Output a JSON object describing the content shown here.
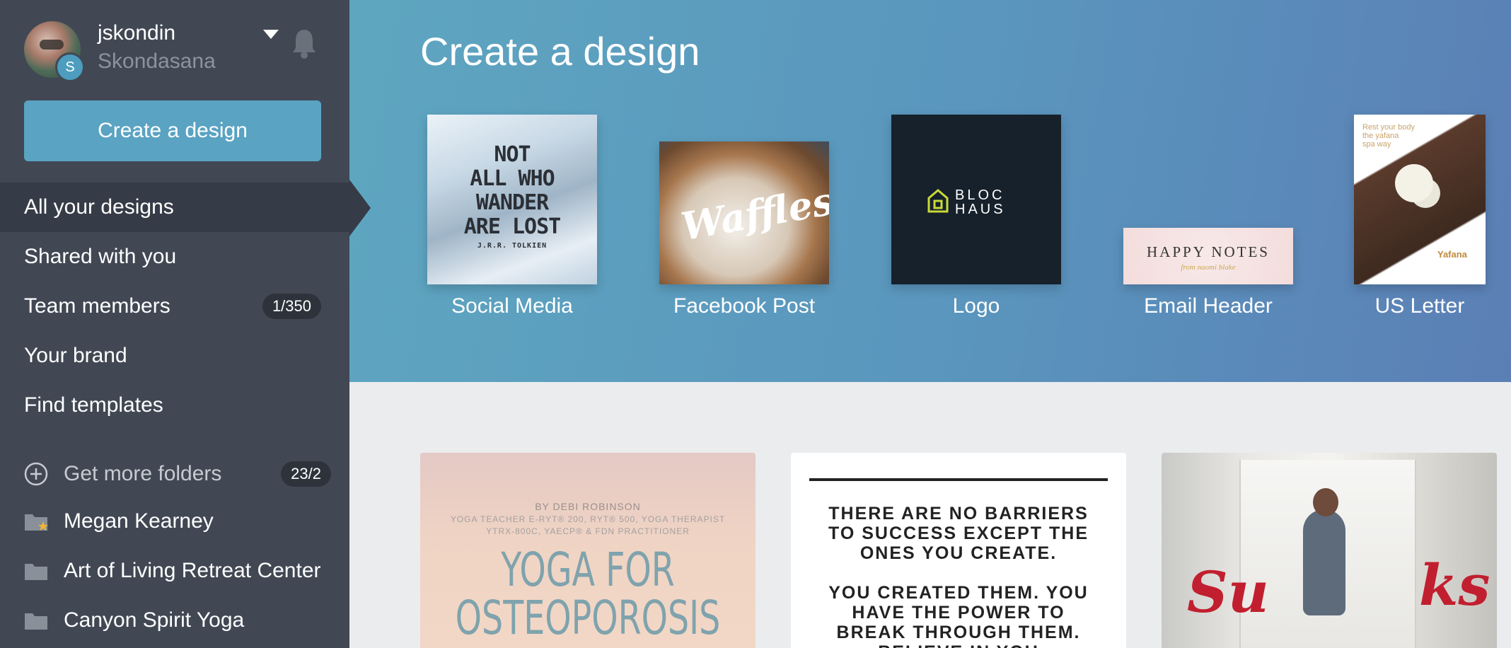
{
  "profile": {
    "username": "jskondin",
    "team": "Skondasana",
    "avatar_letter": "S"
  },
  "sidebar": {
    "create_label": "Create a design",
    "nav": [
      {
        "label": "All your designs"
      },
      {
        "label": "Shared with you"
      },
      {
        "label": "Team members",
        "badge": "1/350"
      },
      {
        "label": "Your brand"
      },
      {
        "label": "Find templates"
      }
    ],
    "more_folders": {
      "label": "Get more folders",
      "badge": "23/2"
    },
    "folders": [
      {
        "label": "Megan Kearney",
        "icon": "folder-star-icon"
      },
      {
        "label": "Art of Living Retreat Center",
        "icon": "folder-icon"
      },
      {
        "label": "Canyon Spirit Yoga",
        "icon": "folder-icon"
      }
    ]
  },
  "banner": {
    "title": "Create a design",
    "templates": [
      {
        "label": "Social Media",
        "thumb_text": [
          "NOT",
          "ALL WHO",
          "WANDER",
          "ARE LOST"
        ],
        "thumb_sub": "J.R.R. TOLKIEN"
      },
      {
        "label": "Facebook Post",
        "thumb_text": "Waffles"
      },
      {
        "label": "Logo",
        "thumb_text": [
          "BLOC",
          "HAUS"
        ]
      },
      {
        "label": "Email Header",
        "thumb_text": "HAPPY NOTES",
        "thumb_sub": "from naomi blake"
      },
      {
        "label": "US Letter",
        "thumb_text": [
          "Rest your body",
          "the yafana",
          "spa way"
        ],
        "thumb_sub": "Yafana"
      }
    ]
  },
  "designs": [
    {
      "by": "BY DEBI ROBINSON",
      "credits": [
        "YOGA TEACHER E-RYT® 200, RYT® 500, YOGA THERAPIST",
        "YTRX-800C, YAECP® & FDN PRACTITIONER"
      ],
      "title": [
        "YOGA FOR",
        "OSTEOPOROSIS"
      ]
    },
    {
      "lines": [
        "THERE ARE NO BARRIERS",
        "TO SUCCESS EXCEPT THE",
        "ONES YOU CREATE.",
        "",
        "YOU CREATED THEM. YOU",
        "HAVE THE POWER TO",
        "BREAK THROUGH THEM.",
        "BELIEVE IN YOU"
      ]
    },
    {
      "overlay_left": "Su",
      "overlay_right": "ks"
    }
  ],
  "colors": {
    "sidebar_bg": "#414854",
    "accent": "#5aa3c2",
    "banner_from": "#5ea6c0",
    "banner_to": "#5b7fb5"
  }
}
